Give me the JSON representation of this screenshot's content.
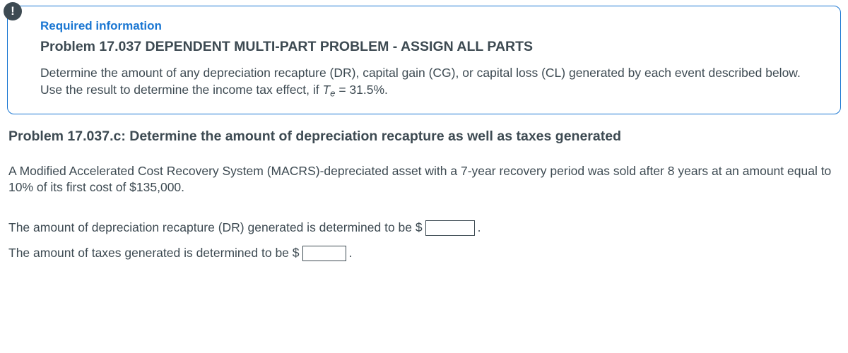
{
  "info_box": {
    "icon_glyph": "!",
    "required_label": "Required information",
    "title": "Problem 17.037 DEPENDENT MULTI-PART PROBLEM - ASSIGN ALL PARTS",
    "desc_pre": "Determine the amount of any depreciation recapture (DR), capital gain (CG), or capital loss (CL) generated by each event described below. Use the result to determine the income tax effect, if ",
    "var": "T",
    "sub": "e",
    "desc_post": " = 31.5%."
  },
  "subproblem_title": "Problem 17.037.c: Determine the amount of depreciation recapture as well as taxes generated",
  "body_text": "A Modified Accelerated Cost Recovery System (MACRS)-depreciated asset with a 7-year recovery period was sold after 8 years at an amount equal to 10% of its first cost of $135,000.",
  "answer1": {
    "pre": "The amount of depreciation recapture (DR) generated is determined to be $",
    "value": "",
    "post": "."
  },
  "answer2": {
    "pre": "The amount of taxes generated is determined to be $",
    "value": "",
    "post": "."
  }
}
